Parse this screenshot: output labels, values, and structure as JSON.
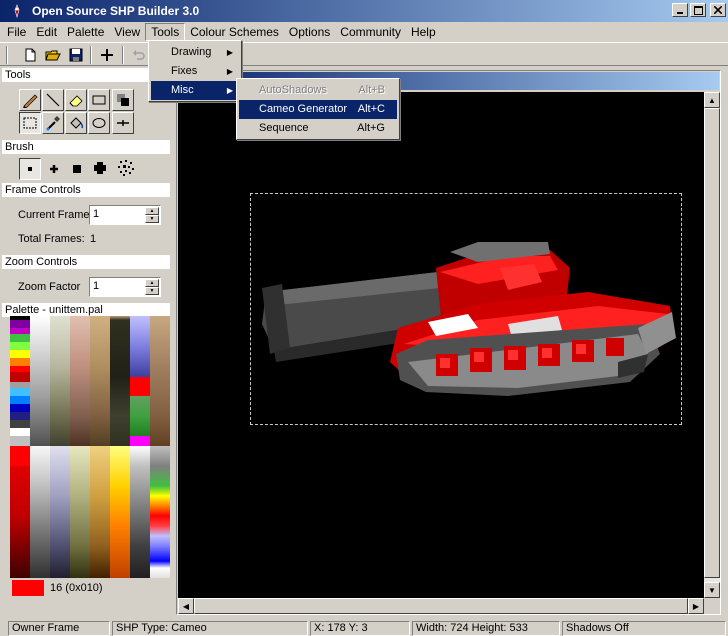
{
  "app": {
    "title": "Open Source SHP Builder 3.0"
  },
  "menubar": {
    "items": [
      "File",
      "Edit",
      "Palette",
      "View",
      "Tools",
      "Colour Schemes",
      "Options",
      "Community",
      "Help"
    ],
    "active": "Tools"
  },
  "tools_menu": {
    "items": [
      {
        "label": "Drawing",
        "submenu": true
      },
      {
        "label": "Fixes",
        "submenu": true
      },
      {
        "label": "Misc",
        "submenu": true,
        "highlighted": true
      }
    ]
  },
  "misc_submenu": {
    "items": [
      {
        "label": "AutoShadows",
        "shortcut": "Alt+B",
        "disabled": true
      },
      {
        "label": "Cameo Generator",
        "shortcut": "Alt+C",
        "highlighted": true
      },
      {
        "label": "Sequence",
        "shortcut": "Alt+G"
      }
    ]
  },
  "left_panel": {
    "tools_header": "Tools",
    "brush_header": "Brush",
    "frame_header": "Frame Controls",
    "current_frame_label": "Current Frame",
    "current_frame_value": "1",
    "total_frames_label": "Total Frames:",
    "total_frames_value": "1",
    "zoom_header": "Zoom Controls",
    "zoom_factor_label": "Zoom Factor",
    "zoom_factor_value": "1",
    "palette_header": "Palette - unittem.pal",
    "selected_color": "#ff0000",
    "selected_color_label": "16 (0x010)"
  },
  "tool_icons": [
    "pencil-icon",
    "line-icon",
    "eraser-icon",
    "rectangle-icon",
    "dark-shade-icon",
    "select-rectangle-icon",
    "eyedropper-icon",
    "flood-fill-icon",
    "ellipse-icon",
    "move-icon"
  ],
  "brush_icons": [
    "brush-1px-icon",
    "brush-3px-icon",
    "brush-5px-icon",
    "brush-round-icon",
    "brush-spray-icon"
  ],
  "statusbar": {
    "owner": "Owner Frame",
    "shp_type": "SHP Type: Cameo",
    "coords": "X: 178 Y: 3",
    "size": "Width: 724 Height: 533",
    "shadows": "Shadows Off"
  },
  "colors": {
    "title_start": "#0a246a",
    "title_end": "#a6caf0",
    "highlight": "#0a246a",
    "canvas": "#000000",
    "tank_red": "#e00000"
  }
}
